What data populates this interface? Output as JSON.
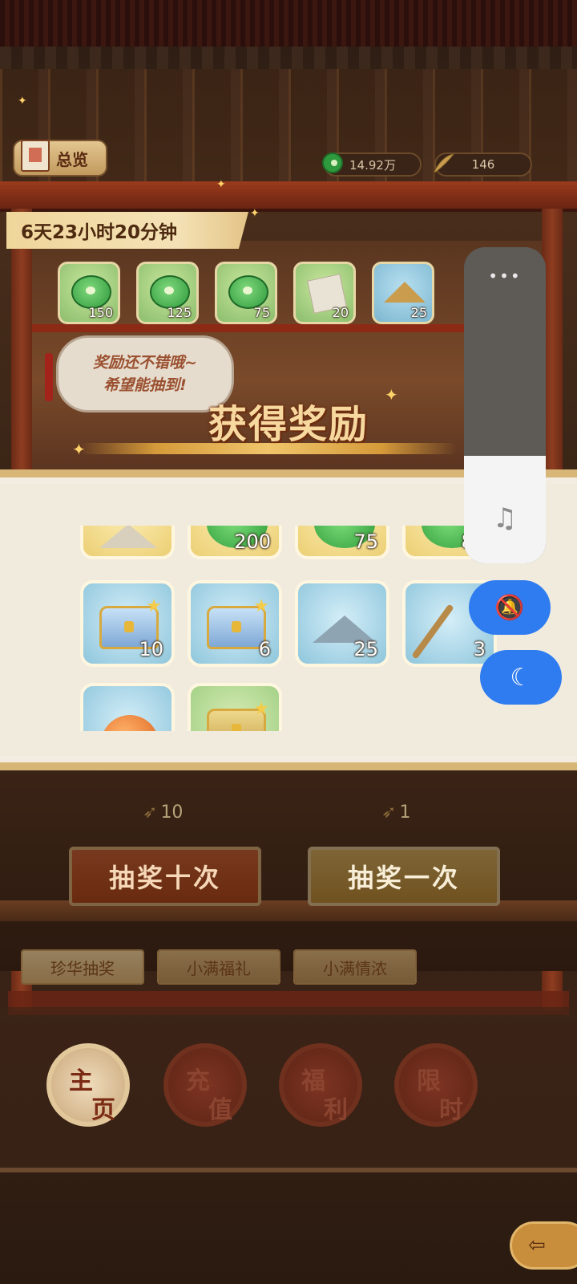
{
  "header": {
    "overview_label": "总览",
    "coin_amount": "14.92万",
    "feather_amount": "146"
  },
  "timer": "6天23小时20分钟",
  "reward_strip": [
    {
      "icon": "jade-coin-icon",
      "count": "150"
    },
    {
      "icon": "jade-coin-icon",
      "count": "125"
    },
    {
      "icon": "jade-coin-icon",
      "count": "75"
    },
    {
      "icon": "paper-icon",
      "count": "20"
    },
    {
      "icon": "sand-pile-icon",
      "count": "25"
    }
  ],
  "bubble": {
    "line1": "奖励还不错哦~",
    "line2": "希望能抽到!"
  },
  "award_title": "获得奖励",
  "rewards": [
    {
      "icon": "tent-icon",
      "count": ""
    },
    {
      "icon": "jade-coin-icon",
      "count": "200"
    },
    {
      "icon": "jade-coin-icon",
      "count": "75"
    },
    {
      "icon": "jade-coin-icon",
      "count": "80"
    },
    {
      "icon": "blue-chest-icon",
      "count": "10"
    },
    {
      "icon": "blue-chest-icon",
      "count": "6"
    },
    {
      "icon": "ore-pile-icon",
      "count": "25"
    },
    {
      "icon": "brush-icon",
      "count": "3"
    },
    {
      "icon": "orange-orb-icon",
      "count": ""
    },
    {
      "icon": "gold-chest-icon",
      "count": ""
    }
  ],
  "draw": {
    "ten_price": "10",
    "ten_label": "抽奖十次",
    "one_price": "1",
    "one_label": "抽奖一次"
  },
  "subtabs": [
    "珍华抽奖",
    "小满福礼",
    "小满情浓"
  ],
  "nav": [
    {
      "top": "主",
      "bottom": "页"
    },
    {
      "top": "充",
      "bottom": "值"
    },
    {
      "top": "福",
      "bottom": "利"
    },
    {
      "top": "限",
      "bottom": "时"
    }
  ],
  "system_overlay": {
    "volume_level_percent": 34,
    "more_glyph": "•••",
    "music_glyph": "♫",
    "bell_glyph": "🔕",
    "moon_glyph": "☾"
  },
  "back_glyph": "⇦",
  "colors": {
    "accent_blue": "#2f7cf0",
    "title_gold": "#f7d9a0"
  }
}
